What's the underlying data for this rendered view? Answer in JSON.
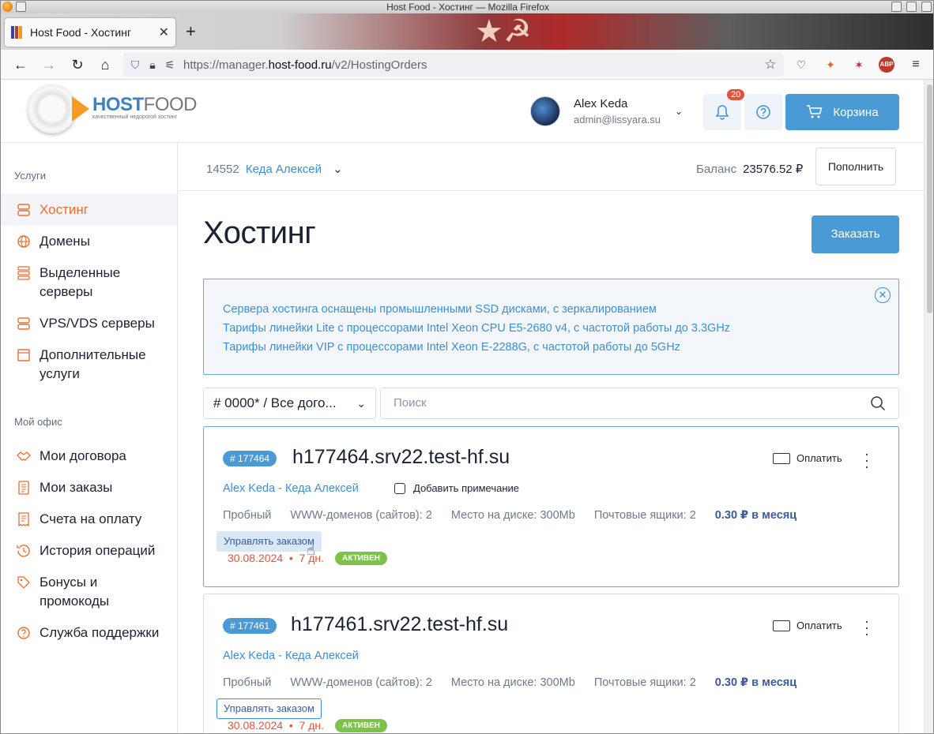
{
  "browser": {
    "window_title": "Host Food - Хостинг — Mozilla Firefox",
    "tab_title": "Host Food - Хостинг",
    "url_prefix": "https://manager.",
    "url_domain": "host-food.ru",
    "url_path": "/v2/HostingOrders"
  },
  "header": {
    "logo_host": "HOST",
    "logo_food": "FOOD",
    "logo_slogan": "качественный недорогой хостинг",
    "user_name": "Alex Keda",
    "user_email": "admin@lissyara.su",
    "notif_count": "20",
    "cart_label": "Корзина"
  },
  "sidebar": {
    "section1": "Услуги",
    "items1": [
      "Хостинг",
      "Домены",
      "Выделенные серверы",
      "VPS/VDS серверы",
      "Дополнительные услуги"
    ],
    "section2": "Мой офис",
    "items2": [
      "Мои договора",
      "Мои заказы",
      "Счета на оплату",
      "История операций",
      "Бонусы и промокоды",
      "Служба поддержки"
    ]
  },
  "account": {
    "id": "14552",
    "name": "Кеда Алексей",
    "balance_label": "Баланс",
    "balance_value": "23576.52 ₽",
    "topup_label": "Пополнить"
  },
  "main": {
    "title": "Хостинг",
    "order_button": "Заказать",
    "notice": [
      "Сервера хостинга оснащены промышленными SSD дисками, с зеркалированием",
      "Тарифы линейки Lite с процессорами Intel Xeon CPU E5-2680 v4, с частотой работы до 3.3GHz",
      "Тарифы линейки VIP с процессорами Intel Xeon E-2288G, с частотой работы до 5GHz"
    ],
    "contract_select": "# 0000* / Все дого...",
    "search_placeholder": "Поиск"
  },
  "orders": [
    {
      "id": "# 177464",
      "host": "h177464.srv22.test-hf.su",
      "pay": "Оплатить",
      "owner": "Alex Keda - Кеда Алексей",
      "note": "Добавить примечание",
      "plan": "Пробный",
      "domains": "WWW-доменов (сайтов): 2",
      "disk": "Место на диске: 300Mb",
      "mail": "Почтовые ящики: 2",
      "price": "0.30 ₽ в месяц",
      "manage": "Управлять заказом",
      "date": "30.08.2024  •  7 дн.",
      "status": "АКТИВЕН"
    },
    {
      "id": "# 177461",
      "host": "h177461.srv22.test-hf.su",
      "pay": "Оплатить",
      "owner": "Alex Keda - Кеда Алексей",
      "plan": "Пробный",
      "domains": "WWW-доменов (сайтов): 2",
      "disk": "Место на диске: 300Mb",
      "mail": "Почтовые ящики: 2",
      "price": "0.30 ₽ в месяц",
      "manage": "Управлять заказом",
      "date": "30.08.2024  •  7 дн.",
      "status": "АКТИВЕН"
    }
  ],
  "colors": {
    "accent": "#4a9bd5",
    "active_menu": "#ea6e34",
    "status": "#7dc24a",
    "date": "#e5533a"
  }
}
